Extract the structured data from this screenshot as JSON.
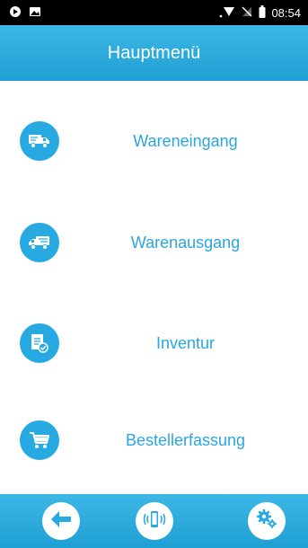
{
  "status_bar": {
    "time": "08:54",
    "icons": [
      "shield-icon",
      "image-icon",
      "wifi-icon",
      "no-sim-icon",
      "battery-icon"
    ]
  },
  "header": {
    "title": "Hauptmenü"
  },
  "menu": {
    "items": [
      {
        "label": "Wareneingang",
        "icon": "truck-incoming-icon"
      },
      {
        "label": "Warenausgang",
        "icon": "truck-outgoing-icon"
      },
      {
        "label": "Inventur",
        "icon": "inventory-clipboard-icon"
      },
      {
        "label": "Bestellerfassung",
        "icon": "shopping-cart-icon"
      }
    ]
  },
  "bottom_bar": {
    "buttons": [
      "back-arrow-icon",
      "device-vibrate-icon",
      "settings-gears-icon"
    ]
  },
  "colors": {
    "primary": "#27a9e1",
    "header_top": "#3cb7e6",
    "header_bottom": "#1f9fd3",
    "label_text": "#29a6df",
    "status_bar": "#000000"
  }
}
